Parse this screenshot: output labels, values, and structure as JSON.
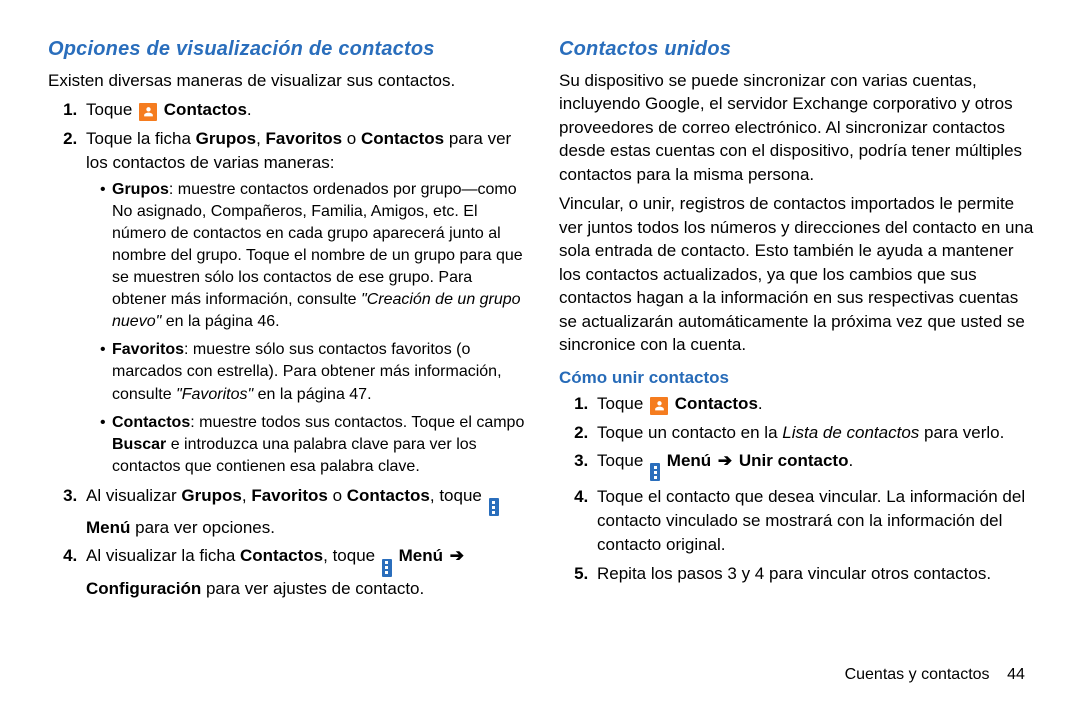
{
  "left": {
    "heading": "Opciones de visualización de contactos",
    "intro": "Existen diversas maneras de visualizar sus contactos.",
    "step1_pre": "Toque ",
    "step1_b": "Contactos",
    "step1_post": ".",
    "step2_a": "Toque la ficha ",
    "step2_b1": "Grupos",
    "step2_c": ", ",
    "step2_b2": "Favoritos",
    "step2_d": " o ",
    "step2_b3": "Contactos",
    "step2_e": " para ver los contactos de varias maneras:",
    "bul1_b": "Grupos",
    "bul1_txt": ": muestre contactos ordenados por grupo—como No asignado, Compañeros, Familia, Amigos, etc. El número de contactos en cada grupo aparecerá junto al nombre del grupo. Toque el nombre de un grupo para que se muestren sólo los contactos de ese grupo. Para obtener más información, consulte ",
    "bul1_it": "\"Creación de un grupo nuevo\"",
    "bul1_post": " en la página 46.",
    "bul2_b": "Favoritos",
    "bul2_txt": ": muestre sólo sus contactos favoritos (o marcados con estrella). Para obtener más información, consulte ",
    "bul2_it": "\"Favoritos\"",
    "bul2_post": " en la página 47.",
    "bul3_b": "Contactos",
    "bul3_txt": ": muestre todos sus contactos. Toque el campo ",
    "bul3_b2": "Buscar",
    "bul3_txt2": " e introduzca una palabra clave para ver los contactos que contienen esa palabra clave.",
    "step3_a": "Al visualizar ",
    "step3_b1": "Grupos",
    "step3_c": ", ",
    "step3_b2": "Favoritos",
    "step3_d": " o ",
    "step3_b3": "Contactos",
    "step3_e": ", toque ",
    "step3_f": "Menú",
    "step3_g": " para ver opciones.",
    "step4_a": "Al visualizar la ficha ",
    "step4_b1": "Contactos",
    "step4_c": ", toque ",
    "step4_b2": "Menú",
    "step4_arrow": "➔",
    "step4_b3": "Configuración",
    "step4_d": " para ver ajustes de contacto."
  },
  "right": {
    "heading": "Contactos unidos",
    "p1": "Su dispositivo se puede sincronizar con varias cuentas, incluyendo Google, el servidor Exchange corporativo y otros proveedores de correo electrónico. Al sincronizar contactos desde estas cuentas con el dispositivo, podría tener múltiples contactos para la misma persona.",
    "p2": "Vincular, o unir, registros de contactos importados le permite ver juntos todos los números y direcciones del contacto en una sola entrada de contacto. Esto también le ayuda a mantener los contactos actualizados, ya que los cambios que sus contactos hagan a la información en sus respectivas cuentas se actualizarán automáticamente la próxima vez que usted se sincronice con la cuenta.",
    "sub": "Cómo unir contactos",
    "s1_pre": "Toque ",
    "s1_b": "Contactos",
    "s1_post": ".",
    "s2_a": "Toque un contacto en la ",
    "s2_i": "Lista de contactos",
    "s2_b": " para verlo.",
    "s3_a": "Toque ",
    "s3_b1": "Menú",
    "s3_arrow": "➔",
    "s3_b2": "Unir contacto",
    "s3_c": ".",
    "s4": "Toque el contacto que desea vincular. La información del contacto vinculado se mostrará con la información del contacto original.",
    "s5": "Repita los pasos 3 y 4 para vincular otros contactos."
  },
  "footer": {
    "section": "Cuentas y contactos",
    "page": "44"
  }
}
